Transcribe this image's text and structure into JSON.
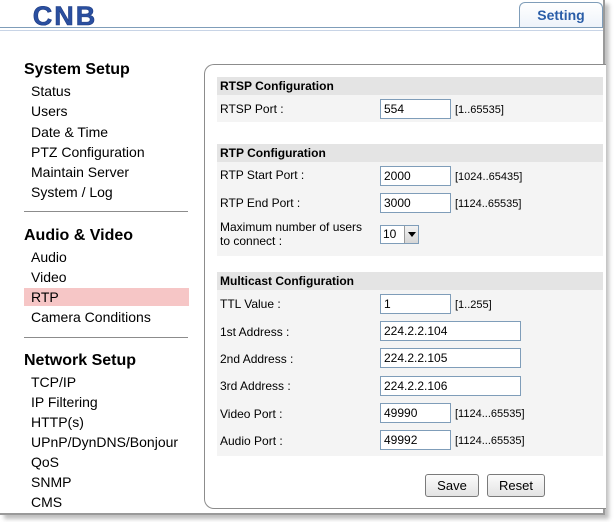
{
  "header": {
    "brand": "CNB",
    "tab_label": "Setting"
  },
  "sidebar": {
    "sections": [
      {
        "title": "System Setup",
        "items": [
          "Status",
          "Users",
          "Date & Time",
          "PTZ Configuration",
          "Maintain Server",
          "System / Log"
        ]
      },
      {
        "title": "Audio & Video",
        "items": [
          "Audio",
          "Video",
          "RTP",
          "Camera Conditions"
        ]
      },
      {
        "title": "Network Setup",
        "items": [
          "TCP/IP",
          "IP Filtering",
          "HTTP(s)",
          "UPnP/DynDNS/Bonjour",
          "QoS",
          "SNMP",
          "CMS"
        ]
      }
    ],
    "active_item": "RTP"
  },
  "rtsp": {
    "heading": "RTSP Configuration",
    "port_label": "RTSP Port :",
    "port_value": "554",
    "port_range": "[1..65535]"
  },
  "rtp": {
    "heading": "RTP Configuration",
    "start_label": "RTP Start Port :",
    "start_value": "2000",
    "start_range": "[1024..65435]",
    "end_label": "RTP End Port :",
    "end_value": "3000",
    "end_range": "[1124..65535]",
    "max_users_label_1": "Maximum number of users",
    "max_users_label_2": "to connect :",
    "max_users_value": "10"
  },
  "multicast": {
    "heading": "Multicast Configuration",
    "ttl_label": "TTL Value :",
    "ttl_value": "1",
    "ttl_range": "[1..255]",
    "addr1_label": "1st Address :",
    "addr1_value": "224.2.2.104",
    "addr2_label": "2nd Address :",
    "addr2_value": "224.2.2.105",
    "addr3_label": "3rd Address :",
    "addr3_value": "224.2.2.106",
    "video_label": "Video Port :",
    "video_value": "49990",
    "video_range": "[1124...65535]",
    "audio_label": "Audio Port :",
    "audio_value": "49992",
    "audio_range": "[1124...65535]"
  },
  "actions": {
    "save_label": "Save",
    "reset_label": "Reset"
  },
  "colors": {
    "brand_blue": "#2a4fa0",
    "active_item_bg": "#f6c6c6",
    "section_header_bg": "#e4e4e4"
  }
}
